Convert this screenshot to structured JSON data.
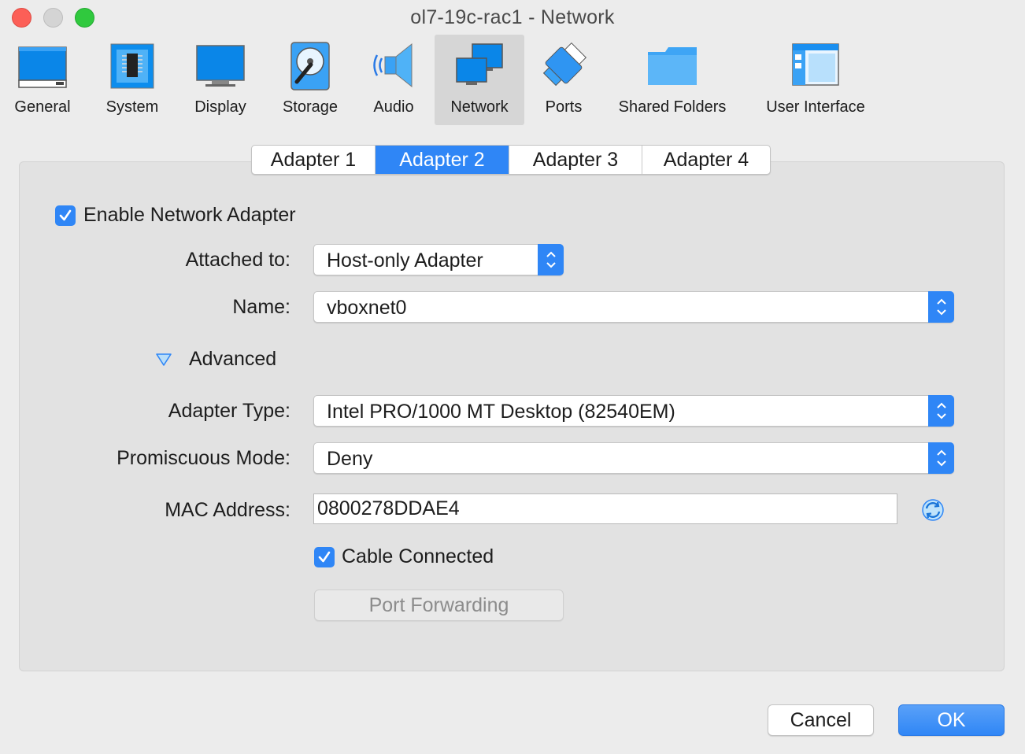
{
  "window": {
    "title": "ol7-19c-rac1 - Network"
  },
  "toolbar": {
    "items": [
      {
        "label": "General",
        "icon": "general-icon"
      },
      {
        "label": "System",
        "icon": "system-icon"
      },
      {
        "label": "Display",
        "icon": "display-icon"
      },
      {
        "label": "Storage",
        "icon": "storage-icon"
      },
      {
        "label": "Audio",
        "icon": "audio-icon"
      },
      {
        "label": "Network",
        "icon": "network-icon",
        "selected": true
      },
      {
        "label": "Ports",
        "icon": "ports-icon"
      },
      {
        "label": "Shared Folders",
        "icon": "shared-folders-icon"
      },
      {
        "label": "User Interface",
        "icon": "user-interface-icon"
      }
    ]
  },
  "tabs": [
    {
      "label": "Adapter 1"
    },
    {
      "label": "Adapter 2",
      "active": true
    },
    {
      "label": "Adapter 3"
    },
    {
      "label": "Adapter 4"
    }
  ],
  "form": {
    "enable_adapter": {
      "label": "Enable Network Adapter",
      "checked": true
    },
    "attached_to": {
      "label": "Attached to:",
      "value": "Host-only Adapter"
    },
    "name": {
      "label": "Name:",
      "value": "vboxnet0"
    },
    "advanced": {
      "label": "Advanced",
      "expanded": true
    },
    "adapter_type": {
      "label": "Adapter Type:",
      "value": "Intel PRO/1000 MT Desktop (82540EM)"
    },
    "promiscuous_mode": {
      "label": "Promiscuous Mode:",
      "value": "Deny"
    },
    "mac_address": {
      "label": "MAC Address:",
      "value": "0800278DDAE4"
    },
    "cable_connected": {
      "label": "Cable Connected",
      "checked": true
    },
    "port_forwarding": {
      "label": "Port Forwarding",
      "enabled": false
    }
  },
  "buttons": {
    "cancel": "Cancel",
    "ok": "OK"
  },
  "colors": {
    "accent": "#2f86f6",
    "background": "#ececec",
    "panel": "#e2e2e2"
  }
}
